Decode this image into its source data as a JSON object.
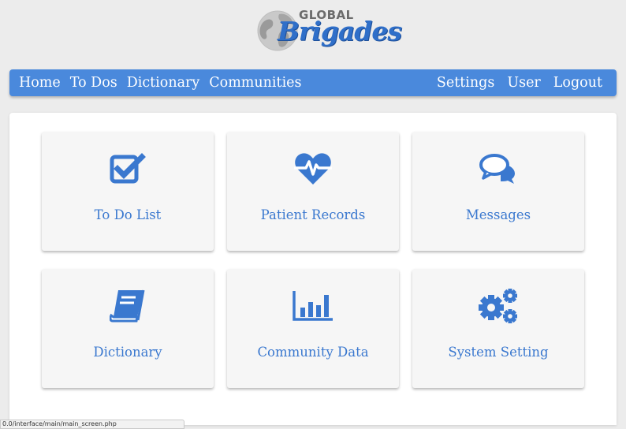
{
  "logo": {
    "line1": "GLOBAL",
    "line2": "Brigades"
  },
  "nav": {
    "left": [
      "Home",
      "To Dos",
      "Dictionary",
      "Communities"
    ],
    "right": [
      "Settings",
      "User",
      "Logout"
    ]
  },
  "cards": [
    {
      "label": "To Do List",
      "icon": "checkbox-icon"
    },
    {
      "label": "Patient Records",
      "icon": "heartbeat-icon"
    },
    {
      "label": "Messages",
      "icon": "chat-bubbles-icon"
    },
    {
      "label": "Dictionary",
      "icon": "book-icon"
    },
    {
      "label": "Community Data",
      "icon": "bar-chart-icon"
    },
    {
      "label": "System Setting",
      "icon": "gears-icon"
    }
  ],
  "status_url": "0.0/interface/main/main_screen.php",
  "colors": {
    "accent": "#4a89dc",
    "card_text": "#3a78cf",
    "background": "#ececec"
  }
}
